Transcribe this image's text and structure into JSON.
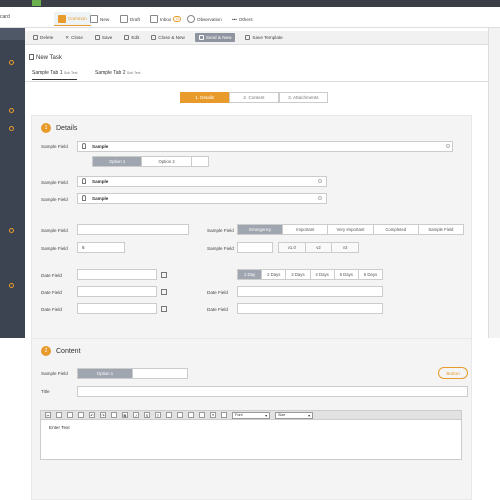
{
  "nav": {
    "left_label": "card",
    "items": [
      {
        "label": "Common"
      },
      {
        "label": "New"
      },
      {
        "label": "Draft"
      },
      {
        "label": "Inbox",
        "badge": "10"
      },
      {
        "label": "Observation"
      },
      {
        "label": "Others"
      }
    ]
  },
  "toolbar": {
    "buttons": [
      {
        "label": "Delete"
      },
      {
        "label": "Close"
      },
      {
        "label": "Save"
      },
      {
        "label": "Edit"
      },
      {
        "label": "Close & New"
      },
      {
        "label": "Send & New"
      },
      {
        "label": "Save Template"
      }
    ]
  },
  "page": {
    "title": "New Task"
  },
  "tabs": [
    {
      "label": "Sample Tab 1",
      "sub": "Sub Text"
    },
    {
      "label": "Sample Tab 2",
      "sub": "Sub Text"
    }
  ],
  "steps": [
    {
      "label": "1.  Details"
    },
    {
      "label": "2.  Content"
    },
    {
      "label": "3.  Attachments"
    }
  ],
  "details": {
    "num": "1",
    "title": "Details",
    "f1_label": "Sample Field",
    "f1_value": "Sample",
    "opt1": "Option 1",
    "opt2": "Option 2",
    "f2_label": "Sample Field",
    "f2_value": "Sample",
    "f3_label": "Sample Field",
    "f3_value": "Sample",
    "f4_label": "Sample Field",
    "f5_label": "Sample Field",
    "f5_value": "6",
    "f6_label": "Sample Field",
    "priority": [
      "Emergency",
      "Important",
      "Very Important",
      "Completed",
      "Sample Field"
    ],
    "f7_label": "Sample Field",
    "ver": [
      "v1.0",
      "v2",
      "v3"
    ],
    "date_label": "Date Field",
    "days": [
      "1 Day",
      "2 Days",
      "3 Days",
      "4 Days",
      "5 Days",
      "6 Days"
    ]
  },
  "content": {
    "num": "2",
    "title": "Content",
    "f1_label": "Sample Field",
    "opt1": "Option 1",
    "button": "Button",
    "title_label": "Title",
    "font_select": "Font",
    "size_select": "Size",
    "editor_text": "Enter Text"
  }
}
